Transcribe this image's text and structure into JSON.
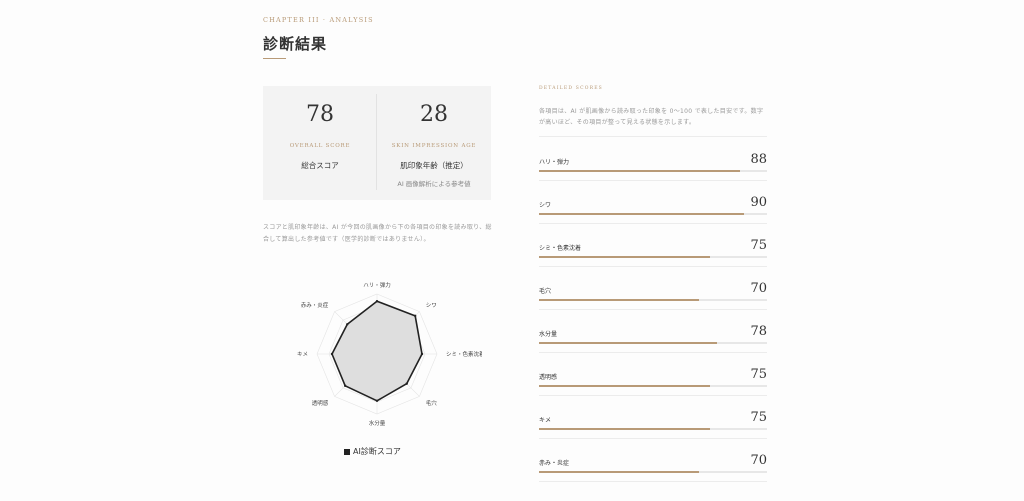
{
  "header": {
    "chapter": "CHAPTER III · ANALYSIS",
    "title": "診断結果"
  },
  "overall": {
    "score": "78",
    "label_en": "OVERALL SCORE",
    "label_jp": "総合スコア"
  },
  "age": {
    "value": "28",
    "label_en": "SKIN IMPRESSION AGE",
    "label_jp": "肌印象年齢（推定）",
    "note": "AI 画像解析による参考値"
  },
  "description": "スコアと肌印象年齢は、AI が今回の肌画像から下の各項目の印象を読み取り、総合して算出した参考値です（医学的診断ではありません）。",
  "radar": {
    "legend": "AI診断スコア",
    "max": 100
  },
  "detailed": {
    "heading": "DETAILED SCORES",
    "description": "各項目は、AI が肌画像から読み取った印象を 0〜100 で表した目安です。数字が高いほど、その項目が整って見える状態を示します。",
    "items": [
      {
        "label": "ハリ・弾力",
        "value": 88
      },
      {
        "label": "シワ",
        "value": 90
      },
      {
        "label": "シミ・色素沈着",
        "value": 75
      },
      {
        "label": "毛穴",
        "value": 70
      },
      {
        "label": "水分量",
        "value": 78
      },
      {
        "label": "透明感",
        "value": 75
      },
      {
        "label": "キメ",
        "value": 75
      },
      {
        "label": "赤み・炎症",
        "value": 70
      }
    ]
  },
  "colors": {
    "accent": "#b89a77",
    "radar_fill": "#dedede",
    "radar_stroke": "#222222"
  }
}
